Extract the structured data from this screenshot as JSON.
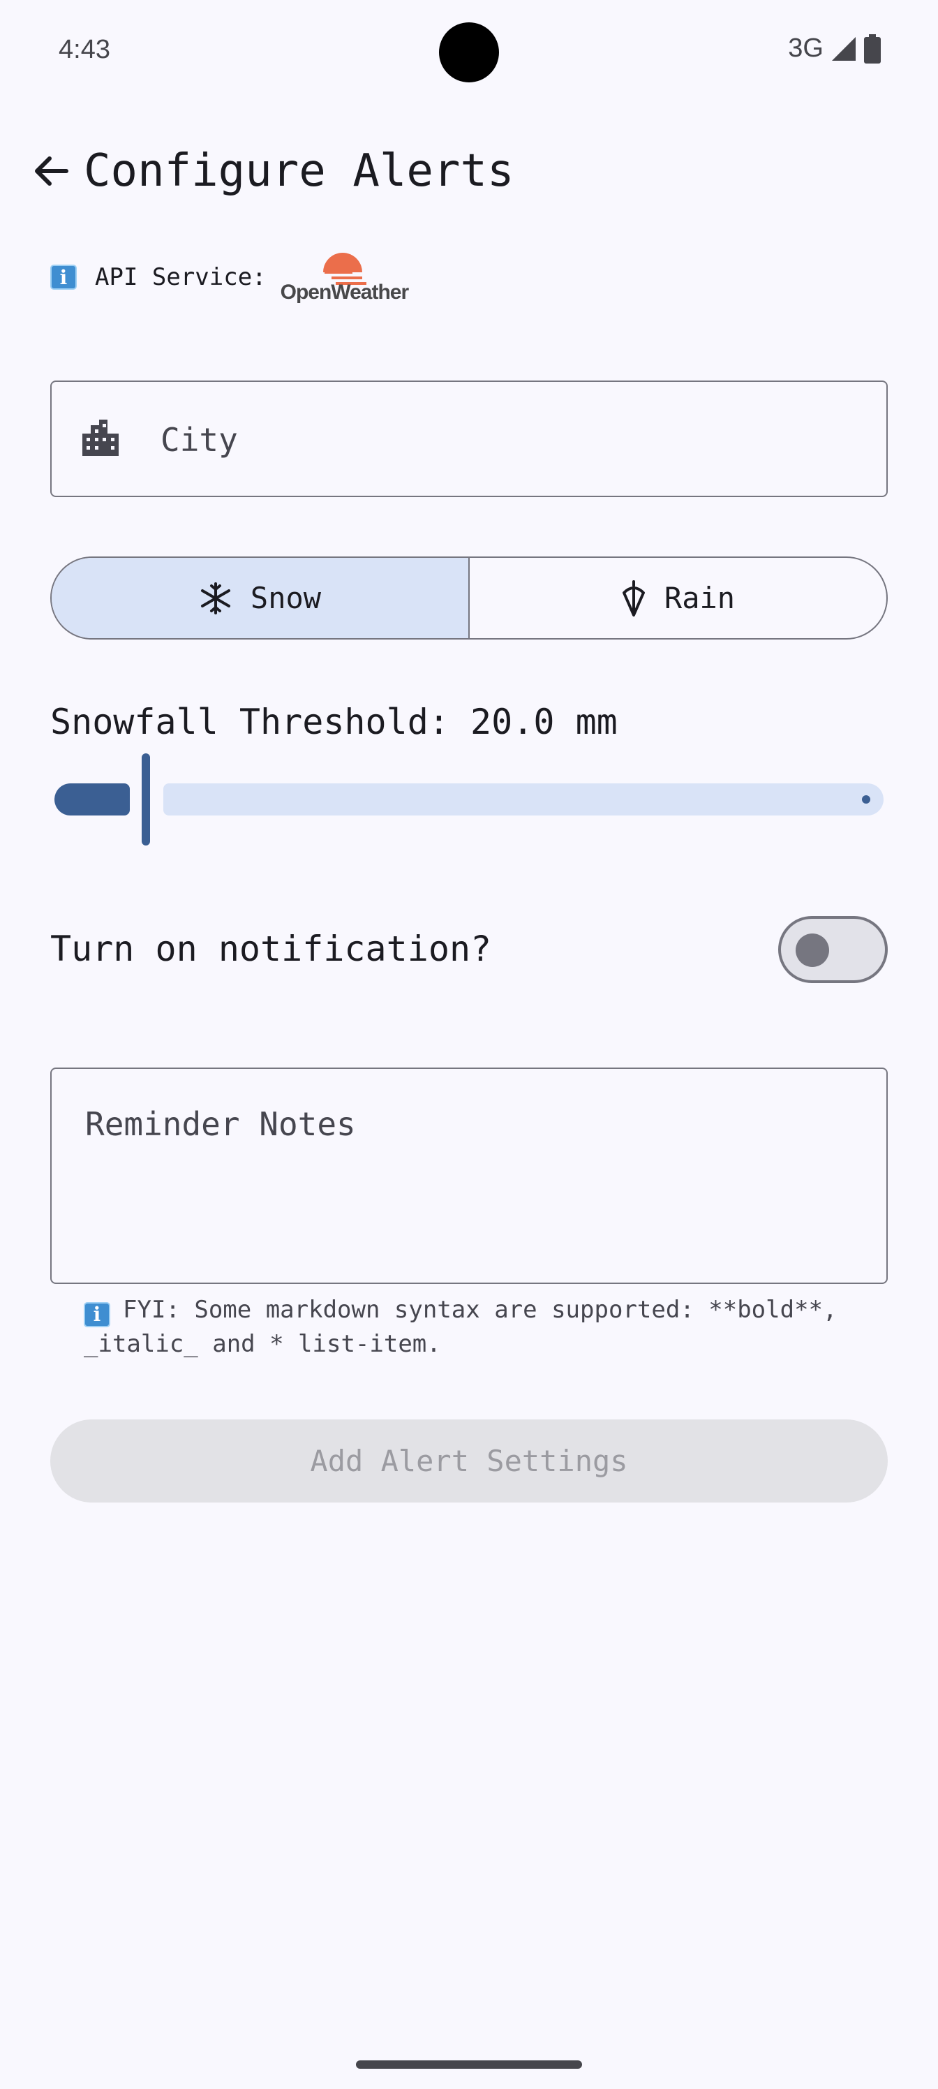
{
  "status_bar": {
    "time": "4:43",
    "network": "3G"
  },
  "header": {
    "title": "Configure Alerts"
  },
  "api_service": {
    "info_glyph": "i",
    "label": "API Service:",
    "provider": "OpenWeather"
  },
  "city_field": {
    "placeholder": "City",
    "value": ""
  },
  "weather_type": {
    "options": [
      {
        "label": "Snow",
        "icon": "snowflake-icon",
        "selected": true
      },
      {
        "label": "Rain",
        "icon": "umbrella-icon",
        "selected": false
      }
    ]
  },
  "threshold": {
    "label": "Snowfall Threshold: 20.0 mm",
    "value_fraction": 0.1
  },
  "notification": {
    "label": "Turn on notification?",
    "enabled": false
  },
  "notes": {
    "placeholder": "Reminder Notes",
    "value": "",
    "hint": "FYI: Some markdown syntax are supported: **bold**, _italic_ and * list-item."
  },
  "actions": {
    "add_label": "Add Alert Settings",
    "add_enabled": false
  },
  "colors": {
    "background": "#f9f8fe",
    "primary": "#3b5f93",
    "segment_selected": "#d9e3f7",
    "outline": "#767680",
    "openweather_orange": "#eb6e4b"
  }
}
